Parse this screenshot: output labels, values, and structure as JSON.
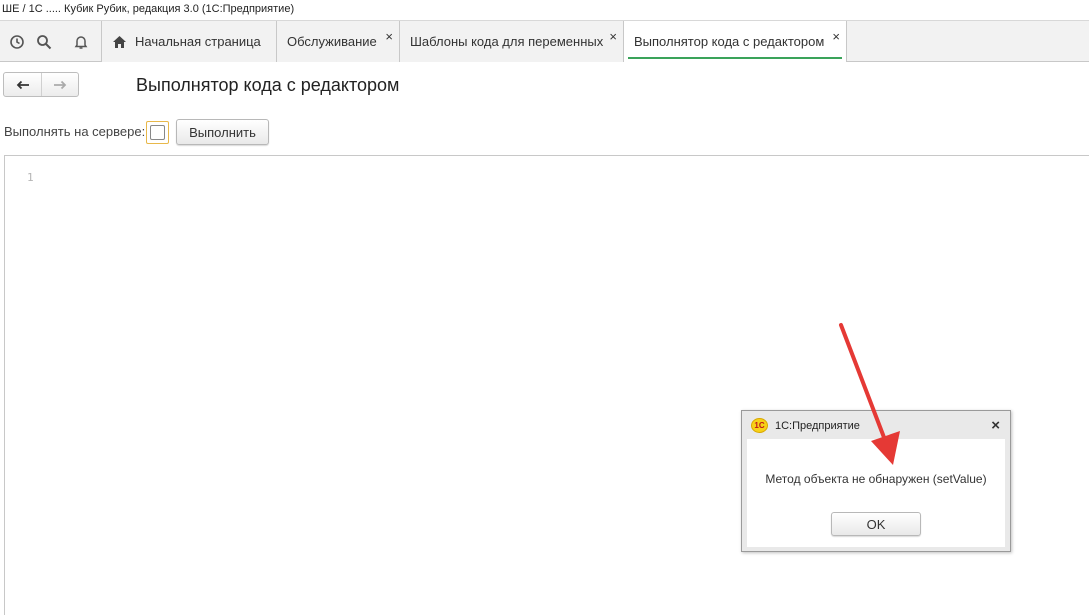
{
  "window": {
    "title": "ШЕ / 1С ..... Кубик Рубик, редакция 3.0  (1С:Предприятие)"
  },
  "toolbar": {
    "icons": [
      "history-icon",
      "search-icon",
      "bell-icon"
    ]
  },
  "tabs": [
    {
      "label": "Начальная страница",
      "icon": "home-icon",
      "closable": false,
      "active": false
    },
    {
      "label": "Обслуживание",
      "closable": true,
      "active": false
    },
    {
      "label": "Шаблоны кода для переменных",
      "closable": true,
      "active": false
    },
    {
      "label": "Выполнятор кода с редактором",
      "closable": true,
      "active": true
    }
  ],
  "tab_close_glyph": "×",
  "page": {
    "title": "Выполнятор кода с редактором",
    "server_label": "Выполнять на сервере:",
    "server_checked": false,
    "execute_button": "Выполнить"
  },
  "editor": {
    "line_numbers": [
      "1"
    ]
  },
  "dialog": {
    "logo_text": "1С",
    "title": "1С:Предприятие",
    "close_glyph": "×",
    "message": "Метод объекта не обнаружен (setValue)",
    "ok_button": "OK"
  },
  "colors": {
    "active_tab_underline": "#3aa35a",
    "checkbox_focus": "#e8b84a",
    "annotation_arrow": "#e53935",
    "logo_yellow": "#f7d117",
    "logo_red": "#c0161b"
  }
}
